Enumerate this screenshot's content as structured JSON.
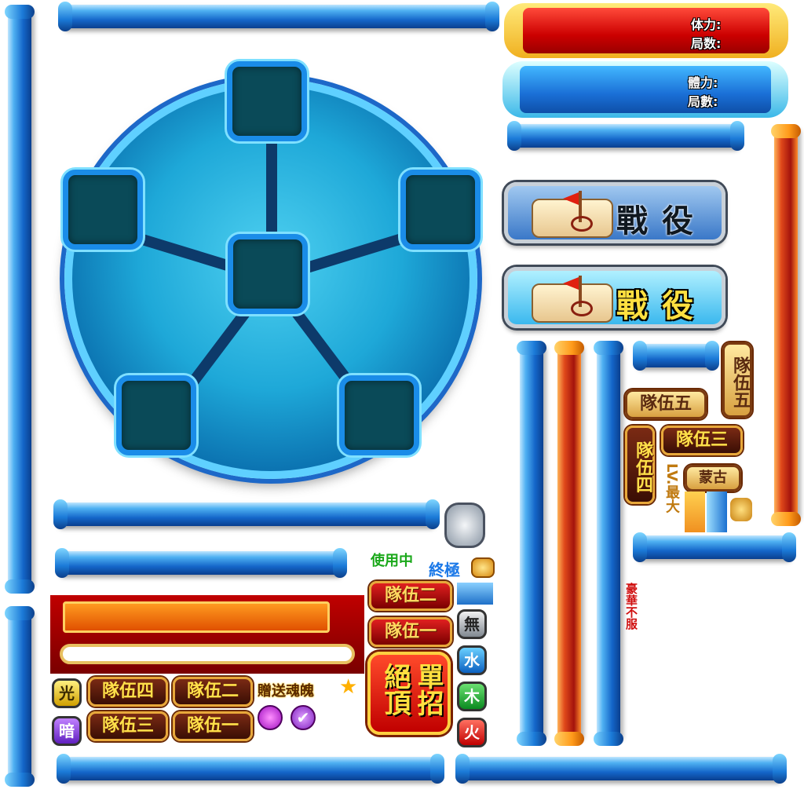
{
  "stamina_red": {
    "stamina_label": "体力:",
    "rounds_label": "局数:"
  },
  "stamina_blue": {
    "stamina_label": "體力:",
    "rounds_label": "局數:"
  },
  "battle_button": {
    "label": "戰役"
  },
  "teams": {
    "team1": "隊伍一",
    "team2": "隊伍二",
    "team3": "隊伍三",
    "team4": "隊伍四",
    "team5": "隊伍五"
  },
  "status": {
    "in_use": "使用中",
    "ultimate": "終極",
    "gift_soul": "贈送魂魄",
    "lv_max": "LV.最大",
    "vertical_text": "豪華不服"
  },
  "skill_button": {
    "line1": "絕頂",
    "line2": "單招"
  },
  "elements": {
    "light": "光",
    "dark": "暗",
    "none": "無",
    "water": "水",
    "wood": "木",
    "fire": "火"
  },
  "small_tag": "蒙古",
  "colors": {
    "blue": "#1466c9",
    "red": "#c00000",
    "gold": "#ffe04a"
  }
}
